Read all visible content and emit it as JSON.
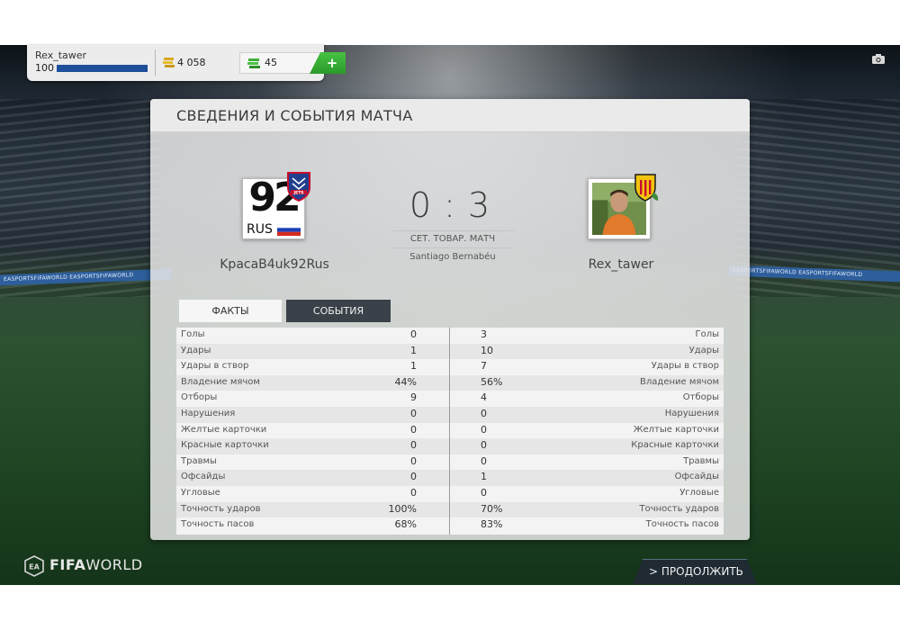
{
  "hud": {
    "username": "Rex_tawer",
    "level": "100",
    "xp_progress": 1.0,
    "coins": "4 058",
    "points": "45",
    "add_label": "+"
  },
  "panel": {
    "title": "СВЕДЕНИЯ И СОБЫТИЯ МАТЧА",
    "home": {
      "name": "KpacaB4uk92Rus",
      "badge_number": "92",
      "badge_country": "RUS"
    },
    "away": {
      "name": "Rex_tawer"
    },
    "score": "0 : 3",
    "match_type": "СЕТ. ТОВАР. МАТЧ",
    "stadium": "Santiago Bernabéu",
    "tabs": [
      {
        "label": "ФАКТЫ",
        "active": false
      },
      {
        "label": "СОБЫТИЯ",
        "active": true
      }
    ],
    "stats": [
      {
        "label": "Голы",
        "home": "0",
        "away": "3"
      },
      {
        "label": "Удары",
        "home": "1",
        "away": "10"
      },
      {
        "label": "Удары в створ",
        "home": "1",
        "away": "7"
      },
      {
        "label": "Владение мячом",
        "home": "44%",
        "away": "56%"
      },
      {
        "label": "Отборы",
        "home": "9",
        "away": "4"
      },
      {
        "label": "Нарушения",
        "home": "0",
        "away": "0"
      },
      {
        "label": "Желтые карточки",
        "home": "0",
        "away": "0"
      },
      {
        "label": "Красные карточки",
        "home": "0",
        "away": "0"
      },
      {
        "label": "Травмы",
        "home": "0",
        "away": "0"
      },
      {
        "label": "Офсайды",
        "home": "0",
        "away": "1"
      },
      {
        "label": "Угловые",
        "home": "0",
        "away": "0"
      },
      {
        "label": "Точность ударов",
        "home": "100%",
        "away": "70%"
      },
      {
        "label": "Точность пасов",
        "home": "68%",
        "away": "83%"
      }
    ]
  },
  "footer": {
    "logo_bold": "FIFA",
    "logo_light": "WORLD",
    "continue_label": "> ПРОДОЛЖИТЬ"
  },
  "background": {
    "adboard_left": "EASPORTSFIFAWORLD   EASPORTSFIFAWORLD",
    "adboard_right": "EASPORTSFIFAWORLD   EASPORTSFIFAWORLD"
  },
  "icons": {
    "coins": "coins-icon",
    "points": "fifa-points-icon",
    "camera": "camera-icon"
  },
  "colors": {
    "accent_green": "#2b9a29",
    "tab_active": "#3a4148",
    "xp_bar": "#1d4f9a"
  }
}
